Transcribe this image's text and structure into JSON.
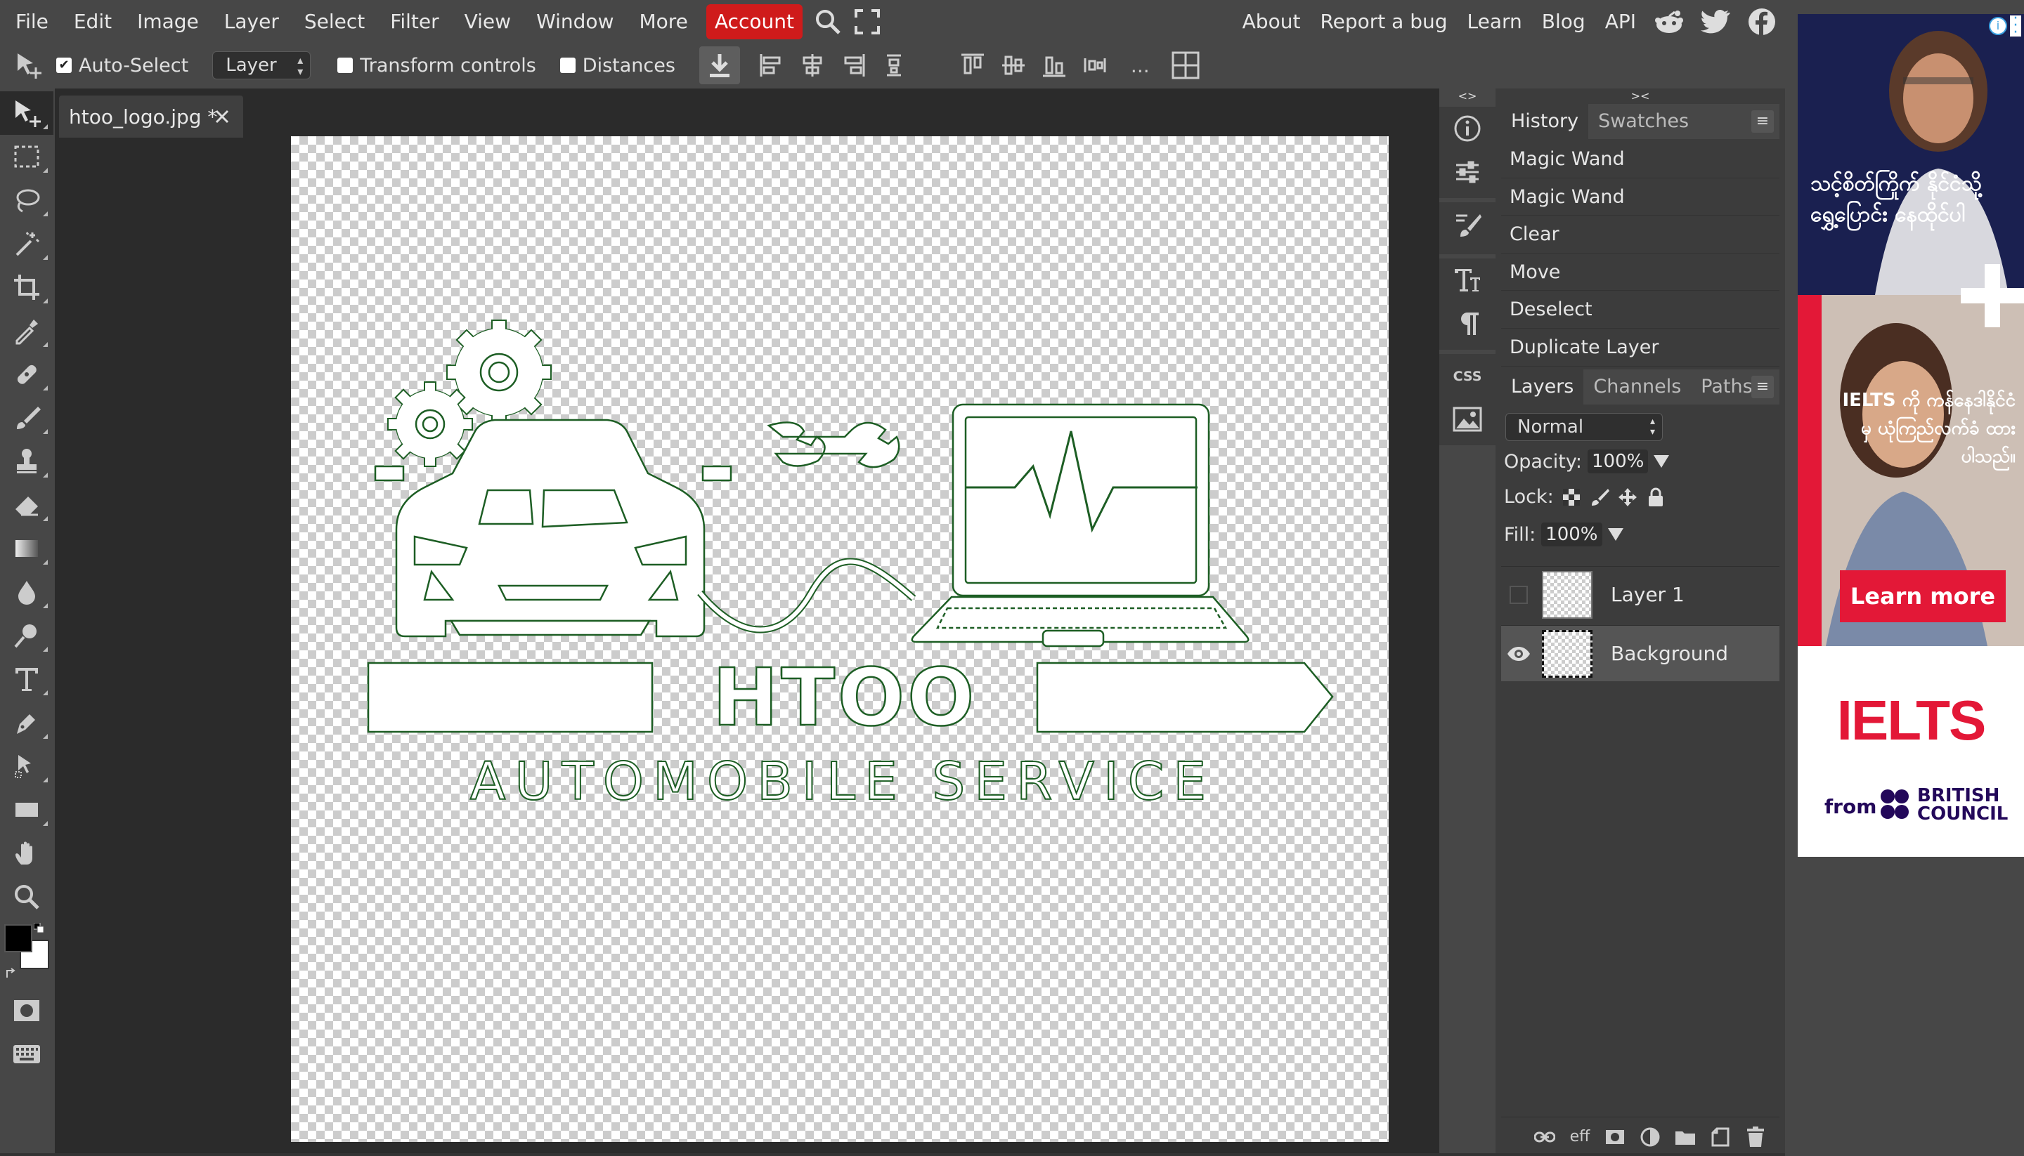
{
  "menu": {
    "items": [
      "File",
      "Edit",
      "Image",
      "Layer",
      "Select",
      "Filter",
      "View",
      "Window",
      "More"
    ],
    "account": "Account",
    "right_items": [
      "About",
      "Report a bug",
      "Learn",
      "Blog",
      "API"
    ]
  },
  "options": {
    "auto_select_label": "Auto-Select",
    "auto_select_checked": true,
    "target_select": "Layer",
    "transform_controls_label": "Transform controls",
    "distances_label": "Distances",
    "more": "..."
  },
  "document": {
    "tab_title": "htoo_logo.jpg *"
  },
  "logo": {
    "title": "HTOO",
    "subtitle": "AUTOMOBILE SERVICE"
  },
  "history_panel": {
    "tabs": [
      "History",
      "Swatches"
    ],
    "items": [
      "Magic Wand",
      "Magic Wand",
      "Clear",
      "Move",
      "Deselect",
      "Duplicate Layer"
    ]
  },
  "layers_panel": {
    "tabs": [
      "Layers",
      "Channels",
      "Paths"
    ],
    "blend_mode": "Normal",
    "opacity_label": "Opacity:",
    "opacity": "100%",
    "lock_label": "Lock:",
    "fill_label": "Fill:",
    "fill": "100%",
    "layers": [
      {
        "name": "Layer 1",
        "visible": false,
        "selected": false
      },
      {
        "name": "Background",
        "visible": true,
        "selected": true
      }
    ],
    "footer_fx": "eff"
  },
  "ad": {
    "myanmar_text_1": "သင့်စိတ်ကြိုက် နိုင်ငံသို့ရွှေ့ပြောင်း နေထိုင်ပါ",
    "myanmar_text_2": "IELTS ကို ကန်နေဒါနိုင်ငံမှ ယုံကြည်လက်ခံ ထားပါသည်။",
    "cta": "Learn more",
    "brand": "IELTS",
    "from": "from",
    "council_line1": "BRITISH",
    "council_line2": "COUNCIL"
  },
  "colors": {
    "accent_red": "#cf1b1b",
    "panel_bg": "#3c3c3c",
    "workspace_bg": "#2b2b2b",
    "logo_outline": "#1d5e24"
  }
}
